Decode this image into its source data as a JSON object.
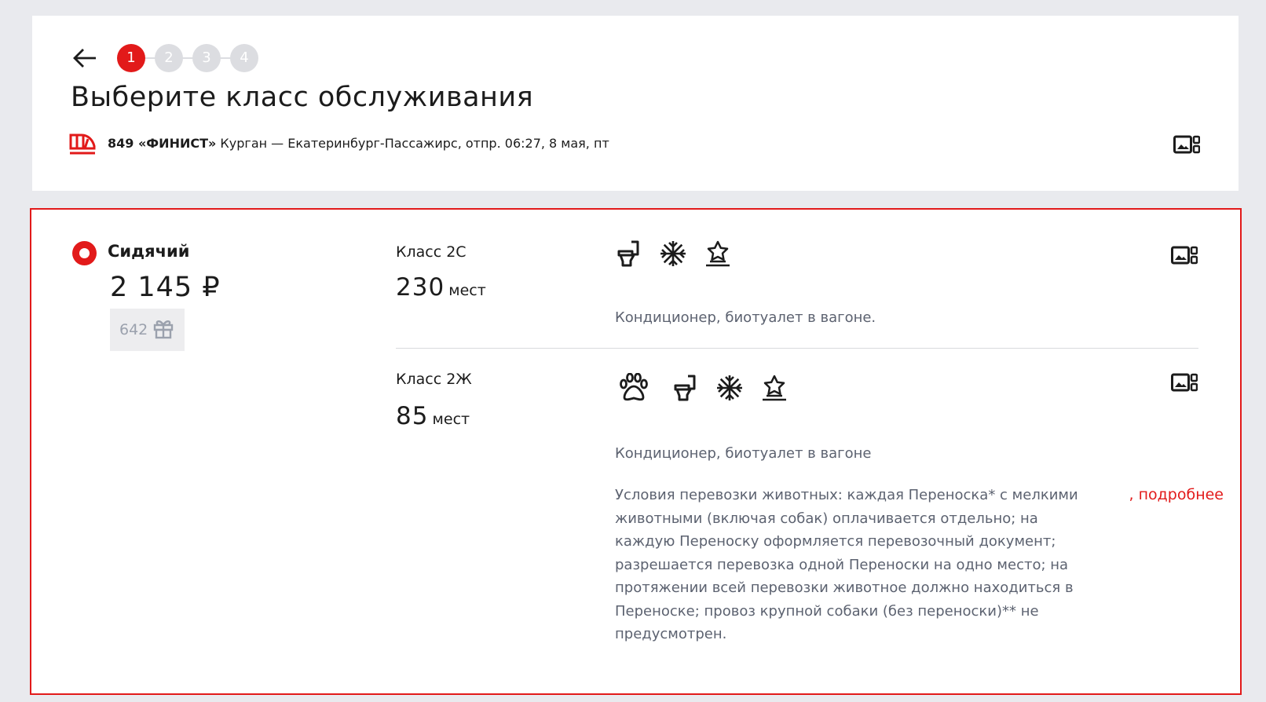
{
  "header": {
    "steps": [
      "1",
      "2",
      "3",
      "4"
    ],
    "active_step": 1,
    "title": "Выберите класс обслуживания",
    "train_name": "849 «ФИНИСТ»",
    "route": " Курган — Екатеринбург-Пассажирс, отпр. 06:27, 8 мая, пт"
  },
  "car_type": {
    "label": "Сидячий",
    "selected": true,
    "price": "2 145 ₽",
    "bonus": "642"
  },
  "classes": [
    {
      "name": "Класс 2С",
      "seats": "230",
      "seats_unit": "мест",
      "icons": [
        "toilet-icon",
        "snowflake-icon",
        "star-icon"
      ],
      "description": "Кондиционер, биотуалет в вагоне."
    },
    {
      "name": "Класс 2Ж",
      "seats": "85",
      "seats_unit": "мест",
      "icons": [
        "paw-icon",
        "toilet-icon",
        "snowflake-icon",
        "star-icon"
      ],
      "description": "Кондиционер, биотуалет в вагоне",
      "pets_text": "Условия перевозки животных: каждая Переноска* с мелкими животными (включая собак) оплачивается отдельно; на каждую Переноску оформляется перевозочный документ; разрешается перевозка одной Переноски на одно место; на протяжении всей перевозки животное должно находиться в Переноске; провоз крупной собаки (без переноски)** не предусмотрен.",
      "more_link": ", подробнее"
    }
  ],
  "colors": {
    "accent": "#e21a1a",
    "background": "#e9eaee",
    "muted": "#5c6270"
  }
}
